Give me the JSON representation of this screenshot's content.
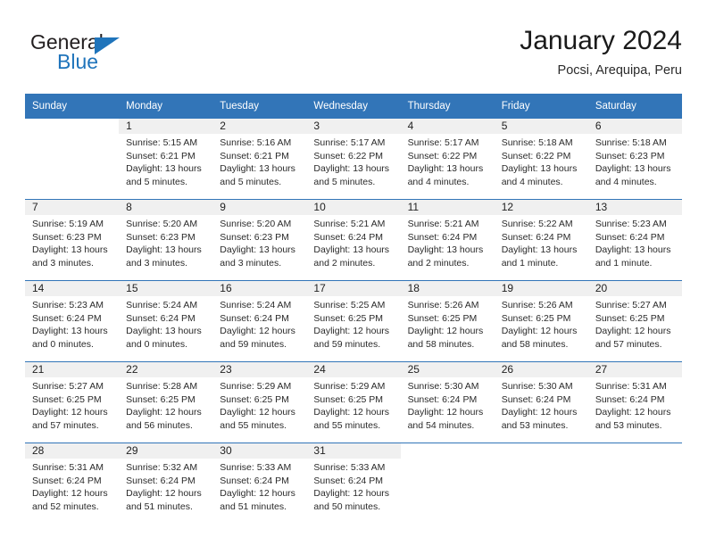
{
  "brand": {
    "name_part1": "General",
    "name_part2": "Blue",
    "accent_color": "#1f74bb"
  },
  "header": {
    "title": "January 2024",
    "subtitle": "Pocsi, Arequipa, Peru"
  },
  "calendar": {
    "header_bg": "#3275b8",
    "daynum_bg": "#f0f0f0",
    "weekday_headers": [
      "Sunday",
      "Monday",
      "Tuesday",
      "Wednesday",
      "Thursday",
      "Friday",
      "Saturday"
    ],
    "weeks": [
      [
        {
          "day": "",
          "sunrise": "",
          "sunset": "",
          "daylight_1": "",
          "daylight_2": ""
        },
        {
          "day": "1",
          "sunrise": "Sunrise: 5:15 AM",
          "sunset": "Sunset: 6:21 PM",
          "daylight_1": "Daylight: 13 hours",
          "daylight_2": "and 5 minutes."
        },
        {
          "day": "2",
          "sunrise": "Sunrise: 5:16 AM",
          "sunset": "Sunset: 6:21 PM",
          "daylight_1": "Daylight: 13 hours",
          "daylight_2": "and 5 minutes."
        },
        {
          "day": "3",
          "sunrise": "Sunrise: 5:17 AM",
          "sunset": "Sunset: 6:22 PM",
          "daylight_1": "Daylight: 13 hours",
          "daylight_2": "and 5 minutes."
        },
        {
          "day": "4",
          "sunrise": "Sunrise: 5:17 AM",
          "sunset": "Sunset: 6:22 PM",
          "daylight_1": "Daylight: 13 hours",
          "daylight_2": "and 4 minutes."
        },
        {
          "day": "5",
          "sunrise": "Sunrise: 5:18 AM",
          "sunset": "Sunset: 6:22 PM",
          "daylight_1": "Daylight: 13 hours",
          "daylight_2": "and 4 minutes."
        },
        {
          "day": "6",
          "sunrise": "Sunrise: 5:18 AM",
          "sunset": "Sunset: 6:23 PM",
          "daylight_1": "Daylight: 13 hours",
          "daylight_2": "and 4 minutes."
        }
      ],
      [
        {
          "day": "7",
          "sunrise": "Sunrise: 5:19 AM",
          "sunset": "Sunset: 6:23 PM",
          "daylight_1": "Daylight: 13 hours",
          "daylight_2": "and 3 minutes."
        },
        {
          "day": "8",
          "sunrise": "Sunrise: 5:20 AM",
          "sunset": "Sunset: 6:23 PM",
          "daylight_1": "Daylight: 13 hours",
          "daylight_2": "and 3 minutes."
        },
        {
          "day": "9",
          "sunrise": "Sunrise: 5:20 AM",
          "sunset": "Sunset: 6:23 PM",
          "daylight_1": "Daylight: 13 hours",
          "daylight_2": "and 3 minutes."
        },
        {
          "day": "10",
          "sunrise": "Sunrise: 5:21 AM",
          "sunset": "Sunset: 6:24 PM",
          "daylight_1": "Daylight: 13 hours",
          "daylight_2": "and 2 minutes."
        },
        {
          "day": "11",
          "sunrise": "Sunrise: 5:21 AM",
          "sunset": "Sunset: 6:24 PM",
          "daylight_1": "Daylight: 13 hours",
          "daylight_2": "and 2 minutes."
        },
        {
          "day": "12",
          "sunrise": "Sunrise: 5:22 AM",
          "sunset": "Sunset: 6:24 PM",
          "daylight_1": "Daylight: 13 hours",
          "daylight_2": "and 1 minute."
        },
        {
          "day": "13",
          "sunrise": "Sunrise: 5:23 AM",
          "sunset": "Sunset: 6:24 PM",
          "daylight_1": "Daylight: 13 hours",
          "daylight_2": "and 1 minute."
        }
      ],
      [
        {
          "day": "14",
          "sunrise": "Sunrise: 5:23 AM",
          "sunset": "Sunset: 6:24 PM",
          "daylight_1": "Daylight: 13 hours",
          "daylight_2": "and 0 minutes."
        },
        {
          "day": "15",
          "sunrise": "Sunrise: 5:24 AM",
          "sunset": "Sunset: 6:24 PM",
          "daylight_1": "Daylight: 13 hours",
          "daylight_2": "and 0 minutes."
        },
        {
          "day": "16",
          "sunrise": "Sunrise: 5:24 AM",
          "sunset": "Sunset: 6:24 PM",
          "daylight_1": "Daylight: 12 hours",
          "daylight_2": "and 59 minutes."
        },
        {
          "day": "17",
          "sunrise": "Sunrise: 5:25 AM",
          "sunset": "Sunset: 6:25 PM",
          "daylight_1": "Daylight: 12 hours",
          "daylight_2": "and 59 minutes."
        },
        {
          "day": "18",
          "sunrise": "Sunrise: 5:26 AM",
          "sunset": "Sunset: 6:25 PM",
          "daylight_1": "Daylight: 12 hours",
          "daylight_2": "and 58 minutes."
        },
        {
          "day": "19",
          "sunrise": "Sunrise: 5:26 AM",
          "sunset": "Sunset: 6:25 PM",
          "daylight_1": "Daylight: 12 hours",
          "daylight_2": "and 58 minutes."
        },
        {
          "day": "20",
          "sunrise": "Sunrise: 5:27 AM",
          "sunset": "Sunset: 6:25 PM",
          "daylight_1": "Daylight: 12 hours",
          "daylight_2": "and 57 minutes."
        }
      ],
      [
        {
          "day": "21",
          "sunrise": "Sunrise: 5:27 AM",
          "sunset": "Sunset: 6:25 PM",
          "daylight_1": "Daylight: 12 hours",
          "daylight_2": "and 57 minutes."
        },
        {
          "day": "22",
          "sunrise": "Sunrise: 5:28 AM",
          "sunset": "Sunset: 6:25 PM",
          "daylight_1": "Daylight: 12 hours",
          "daylight_2": "and 56 minutes."
        },
        {
          "day": "23",
          "sunrise": "Sunrise: 5:29 AM",
          "sunset": "Sunset: 6:25 PM",
          "daylight_1": "Daylight: 12 hours",
          "daylight_2": "and 55 minutes."
        },
        {
          "day": "24",
          "sunrise": "Sunrise: 5:29 AM",
          "sunset": "Sunset: 6:25 PM",
          "daylight_1": "Daylight: 12 hours",
          "daylight_2": "and 55 minutes."
        },
        {
          "day": "25",
          "sunrise": "Sunrise: 5:30 AM",
          "sunset": "Sunset: 6:24 PM",
          "daylight_1": "Daylight: 12 hours",
          "daylight_2": "and 54 minutes."
        },
        {
          "day": "26",
          "sunrise": "Sunrise: 5:30 AM",
          "sunset": "Sunset: 6:24 PM",
          "daylight_1": "Daylight: 12 hours",
          "daylight_2": "and 53 minutes."
        },
        {
          "day": "27",
          "sunrise": "Sunrise: 5:31 AM",
          "sunset": "Sunset: 6:24 PM",
          "daylight_1": "Daylight: 12 hours",
          "daylight_2": "and 53 minutes."
        }
      ],
      [
        {
          "day": "28",
          "sunrise": "Sunrise: 5:31 AM",
          "sunset": "Sunset: 6:24 PM",
          "daylight_1": "Daylight: 12 hours",
          "daylight_2": "and 52 minutes."
        },
        {
          "day": "29",
          "sunrise": "Sunrise: 5:32 AM",
          "sunset": "Sunset: 6:24 PM",
          "daylight_1": "Daylight: 12 hours",
          "daylight_2": "and 51 minutes."
        },
        {
          "day": "30",
          "sunrise": "Sunrise: 5:33 AM",
          "sunset": "Sunset: 6:24 PM",
          "daylight_1": "Daylight: 12 hours",
          "daylight_2": "and 51 minutes."
        },
        {
          "day": "31",
          "sunrise": "Sunrise: 5:33 AM",
          "sunset": "Sunset: 6:24 PM",
          "daylight_1": "Daylight: 12 hours",
          "daylight_2": "and 50 minutes."
        },
        {
          "day": "",
          "sunrise": "",
          "sunset": "",
          "daylight_1": "",
          "daylight_2": ""
        },
        {
          "day": "",
          "sunrise": "",
          "sunset": "",
          "daylight_1": "",
          "daylight_2": ""
        },
        {
          "day": "",
          "sunrise": "",
          "sunset": "",
          "daylight_1": "",
          "daylight_2": ""
        }
      ]
    ]
  }
}
